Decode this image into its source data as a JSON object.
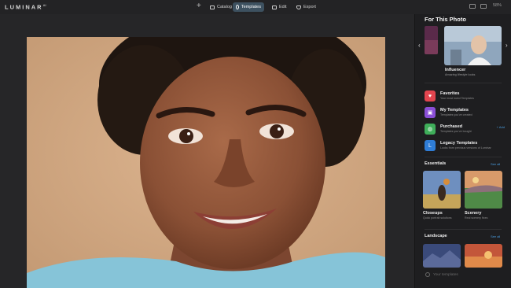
{
  "app": {
    "logo": "LUMINAR",
    "logo_version": "AI"
  },
  "nav": {
    "add_label": "+",
    "catalog": "Catalog",
    "templates": "Templates",
    "edit": "Edit",
    "export": "Export",
    "active_tab": "Templates"
  },
  "toolbar": {
    "zoom": "58%"
  },
  "panel": {
    "title": "For This Photo",
    "featured": {
      "title": "Influencer",
      "subtitle": "Amazing lifestyle looks"
    },
    "categories": [
      {
        "title": "Favorites",
        "subtitle": "Your most loved Templates",
        "icon": "heart-icon",
        "color": "#e2454f"
      },
      {
        "title": "My Templates",
        "subtitle": "Templates you've created",
        "icon": "user-template-icon",
        "color": "#8a4fd6"
      },
      {
        "title": "Purchased",
        "subtitle": "Templates you've bought",
        "icon": "bag-icon",
        "color": "#3fae5a",
        "action": "+ Add"
      },
      {
        "title": "Legacy Templates",
        "subtitle": "Looks from previous versions of Luminar",
        "icon": "legacy-icon",
        "color": "#2f7dd6"
      }
    ],
    "essentials": {
      "title": "Essentials",
      "see_all": "See all",
      "items": [
        {
          "title": "Closeups",
          "subtitle": "Quick portrait solutions"
        },
        {
          "title": "Scenery",
          "subtitle": "Real scenery fixes"
        }
      ]
    },
    "landscape": {
      "title": "Landscape",
      "see_all": "See all"
    },
    "your_templates": "Your templates"
  },
  "colors": {
    "accent": "#4a9de0",
    "active_tab_bg": "#3d5160",
    "background": "#1d1d1f"
  }
}
